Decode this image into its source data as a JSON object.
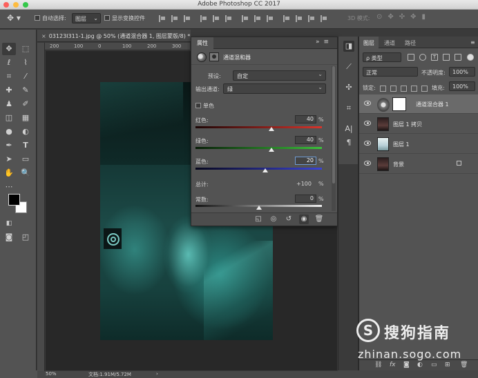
{
  "window": {
    "title": "Adobe Photoshop CC 2017"
  },
  "options_bar": {
    "auto_select_label": "自动选择:",
    "auto_select_value": "图层",
    "show_transform_label": "显示变换控件",
    "mode_3d_label": "3D 模式:"
  },
  "document": {
    "tab_title": "03123I311-1.jpg @ 50% (通道混合器 1, 图层蒙版/8) *",
    "ruler_ticks": [
      "200",
      "100",
      "0",
      "100",
      "200",
      "300"
    ]
  },
  "properties": {
    "tab_label": "属性",
    "adjustment_name": "通道混和器",
    "preset_label": "预设:",
    "preset_value": "自定",
    "output_channel_label": "输出通道:",
    "output_channel_value": "绿",
    "monochrome_label": "单色",
    "channels": [
      {
        "label": "红色:",
        "value": "40",
        "percent": 40,
        "color": "#d9342b"
      },
      {
        "label": "绿色:",
        "value": "40",
        "percent": 40,
        "color": "#3bc23a"
      },
      {
        "label": "蓝色:",
        "value": "20",
        "percent": 20,
        "color": "#3a43d6"
      }
    ],
    "total_label": "总计:",
    "total_value": "+100",
    "constant_label": "常数:",
    "constant_value": "0",
    "percent_sign": "%"
  },
  "layers_panel": {
    "tabs": [
      "图层",
      "通道",
      "路径"
    ],
    "filter_type": "ρ 类型",
    "blend_mode": "正常",
    "opacity_label": "不透明度:",
    "opacity_value": "100%",
    "lock_label": "锁定:",
    "fill_label": "填充:",
    "fill_value": "100%",
    "layers": [
      {
        "name": "通道混合器 1",
        "selected": true
      },
      {
        "name": "图层 1 拷贝",
        "selected": false
      },
      {
        "name": "图层 1",
        "selected": false
      },
      {
        "name": "背景",
        "selected": false,
        "locked": true
      }
    ],
    "footer_icons": [
      "link-icon",
      "fx-icon",
      "mask-icon",
      "adjustment-icon",
      "folder-icon",
      "new-layer-icon",
      "trash-icon"
    ]
  },
  "status": {
    "zoom": "50%",
    "doc_size": "文档:1.91M/5.72M"
  },
  "watermark": {
    "logo": "S",
    "text": "搜狗指南",
    "url": "zhinan.sogo.com"
  }
}
